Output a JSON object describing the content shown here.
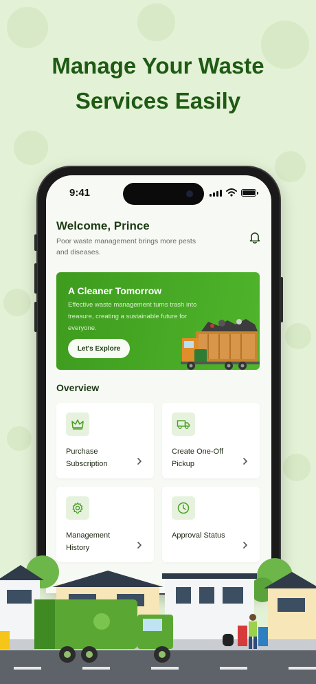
{
  "headline": {
    "line1": "Manage Your Waste",
    "line2": "Services Easily"
  },
  "status_bar": {
    "time": "9:41"
  },
  "header": {
    "welcome": "Welcome, Prince",
    "tagline": "Poor waste management brings more pests and diseases.",
    "bell_icon": "bell-icon"
  },
  "banner": {
    "title": "A Cleaner Tomorrow",
    "text": "Effective waste management turns trash into treasure, creating a sustainable future for everyone.",
    "button_label": "Let's Explore"
  },
  "overview": {
    "title": "Overview",
    "cards": [
      {
        "label": "Purchase Subscription",
        "icon": "crown-icon"
      },
      {
        "label": "Create One-Off Pickup",
        "icon": "truck-icon"
      },
      {
        "label": "Management History",
        "icon": "gear-icon"
      },
      {
        "label": "Approval Status",
        "icon": "clock-icon"
      }
    ]
  },
  "colors": {
    "brand_green": "#4fb52b",
    "headline_green": "#1e5a14",
    "background": "#e3f1d6"
  }
}
